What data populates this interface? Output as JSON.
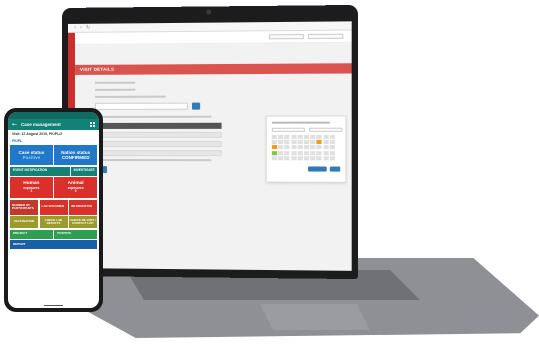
{
  "laptop": {
    "browser_url": "",
    "visit_banner": "VISIT DETAILS"
  },
  "phone": {
    "status_bar": {
      "time": "",
      "icons": ""
    },
    "app_title": "Case management",
    "subline_1": "Visit: 12 August 2019, PK/PL/2",
    "subline_2": "PK/PL",
    "case_status": {
      "label": "Case status",
      "value": "Positive"
    },
    "nation_status": {
      "label": "Nation status",
      "value": "CONFIRMED"
    },
    "event_notification": "EVENT NOTIFICATION",
    "event_right": "INVESTIGATE",
    "human_exposure": {
      "label": "Human",
      "sub": "exposures",
      "count": "3"
    },
    "animal_exposure": {
      "label": "Animal",
      "sub": "exposures",
      "count": "0"
    },
    "row4": [
      "NUMBER OF PARTICIPANTS",
      "LAB SPECIMEN",
      "INFORMATION"
    ],
    "row5": [
      "VACCINATION",
      "CHECK LAB RESULTS",
      "CHECK RE-VISIT / CONTACT LIST"
    ],
    "row6": [
      "PROJECT",
      "POSITIVE"
    ],
    "row7": "REPORT",
    "colors": {
      "header": "#138178",
      "red": "#d9302a",
      "blue": "#1f78c8",
      "green": "#2e9e4f",
      "olive": "#9c9a2a"
    }
  }
}
